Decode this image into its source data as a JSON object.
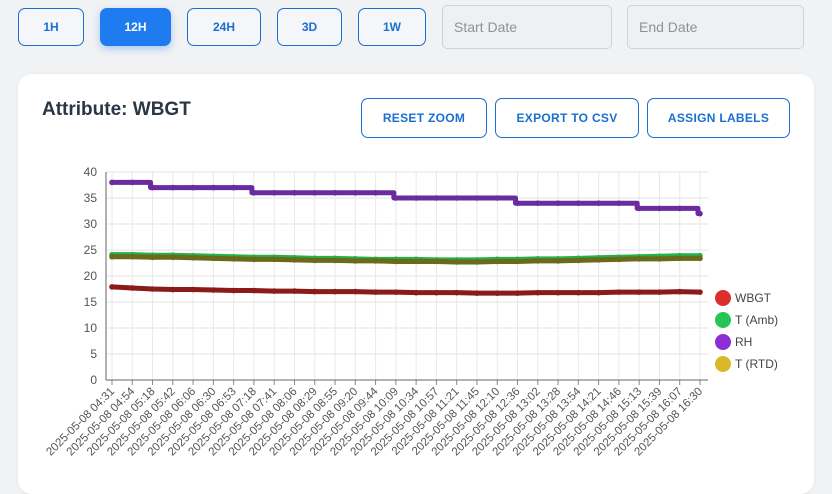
{
  "toolbar": {
    "ranges": [
      "1H",
      "12H",
      "24H",
      "3D",
      "1W"
    ],
    "active_range": "12H",
    "start_placeholder": "Start Date",
    "end_placeholder": "End Date"
  },
  "card": {
    "title": "Attribute: WBGT",
    "reset_zoom": "RESET ZOOM",
    "export_csv": "EXPORT TO CSV",
    "assign_labels": "ASSIGN LABELS"
  },
  "colors": {
    "accent": "#1f7cf0",
    "button_border": "#1a6fd0"
  },
  "chart_data": {
    "type": "line",
    "title": "",
    "xlabel": "",
    "ylabel": "",
    "ylim": [
      0,
      40
    ],
    "yticks": [
      0,
      5,
      10,
      15,
      20,
      25,
      30,
      35,
      40
    ],
    "grid": true,
    "legend_position": "right",
    "x": [
      "2025-05-08 04:31",
      "2025-05-08 04:54",
      "2025-05-08 05:18",
      "2025-05-08 05:42",
      "2025-05-08 06:06",
      "2025-05-08 06:30",
      "2025-05-08 06:53",
      "2025-05-08 07:18",
      "2025-05-08 07:41",
      "2025-05-08 08:06",
      "2025-05-08 08:29",
      "2025-05-08 08:55",
      "2025-05-08 09:20",
      "2025-05-08 09:44",
      "2025-05-08 10:09",
      "2025-05-08 10:34",
      "2025-05-08 10:57",
      "2025-05-08 11:21",
      "2025-05-08 11:45",
      "2025-05-08 12:10",
      "2025-05-08 12:36",
      "2025-05-08 13:02",
      "2025-05-08 13:28",
      "2025-05-08 13:54",
      "2025-05-08 14:21",
      "2025-05-08 14:46",
      "2025-05-08 15:13",
      "2025-05-08 15:39",
      "2025-05-08 16:07",
      "2025-05-08 16:30"
    ],
    "series": [
      {
        "name": "WBGT",
        "color": "#8b1a1a",
        "legend_color": "#dd2e2e",
        "values": [
          17.9,
          17.7,
          17.5,
          17.4,
          17.4,
          17.3,
          17.2,
          17.2,
          17.1,
          17.1,
          17.0,
          17.0,
          17.0,
          16.9,
          16.9,
          16.8,
          16.8,
          16.8,
          16.7,
          16.7,
          16.7,
          16.8,
          16.8,
          16.8,
          16.8,
          16.9,
          16.9,
          16.9,
          17.0,
          16.9
        ]
      },
      {
        "name": "T (Amb)",
        "color": "#25b04a",
        "legend_color": "#27c456",
        "values": [
          24.1,
          24.1,
          24.0,
          24.0,
          23.9,
          23.8,
          23.7,
          23.6,
          23.6,
          23.5,
          23.4,
          23.4,
          23.3,
          23.2,
          23.2,
          23.2,
          23.1,
          23.1,
          23.1,
          23.2,
          23.2,
          23.3,
          23.3,
          23.4,
          23.5,
          23.6,
          23.7,
          23.8,
          23.9,
          23.9
        ]
      },
      {
        "name": "RH",
        "color": "#6a2ba0",
        "legend_color": "#8b2fd4",
        "values": [
          38,
          38,
          37,
          37,
          37,
          37,
          37,
          36,
          36,
          36,
          36,
          36,
          36,
          36,
          35,
          35,
          35,
          35,
          35,
          35,
          34,
          34,
          34,
          34,
          34,
          34,
          33,
          33,
          33,
          32
        ]
      },
      {
        "name": "T (RTD)",
        "color": "#6a6a1a",
        "legend_color": "#d8b92a",
        "values": [
          23.7,
          23.7,
          23.6,
          23.6,
          23.5,
          23.4,
          23.3,
          23.2,
          23.2,
          23.1,
          23.0,
          23.0,
          22.9,
          22.9,
          22.8,
          22.8,
          22.8,
          22.7,
          22.7,
          22.8,
          22.8,
          22.9,
          22.9,
          23.0,
          23.1,
          23.2,
          23.3,
          23.3,
          23.4,
          23.4
        ]
      }
    ]
  }
}
